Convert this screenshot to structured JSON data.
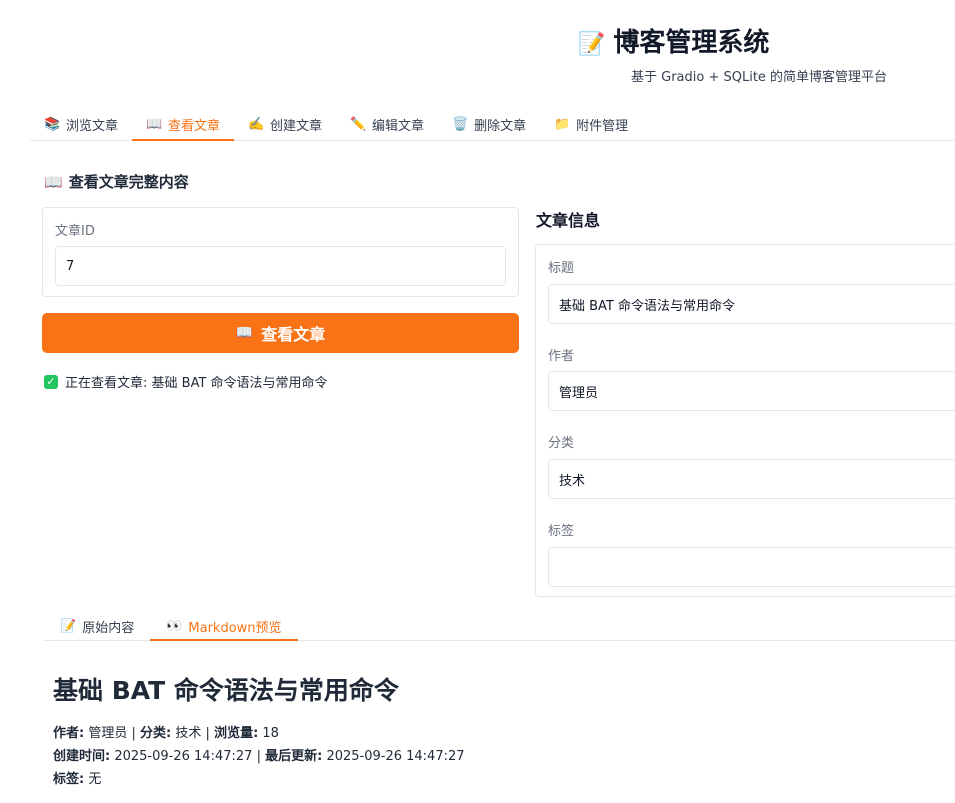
{
  "header": {
    "title": "博客管理系统",
    "title_icon": "memo-icon",
    "subtitle": "基于 Gradio + SQLite 的简单博客管理平台"
  },
  "tabs": [
    {
      "icon": "📚",
      "icon_name": "books-icon",
      "label": "浏览文章"
    },
    {
      "icon": "📖",
      "icon_name": "open-book-icon",
      "label": "查看文章",
      "active": true
    },
    {
      "icon": "✍️",
      "icon_name": "writing-hand-icon",
      "label": "创建文章"
    },
    {
      "icon": "✏️",
      "icon_name": "pencil-icon",
      "label": "编辑文章"
    },
    {
      "icon": "🗑️",
      "icon_name": "trash-icon",
      "label": "删除文章"
    },
    {
      "icon": "📁",
      "icon_name": "folder-icon",
      "label": "附件管理"
    }
  ],
  "view": {
    "section_icon": "📖",
    "section_title": "查看文章完整内容",
    "id_label": "文章ID",
    "id_value": "7",
    "button_icon": "📖",
    "button_label": "查看文章",
    "status_text": "正在查看文章: 基础 BAT 命令语法与常用命令"
  },
  "info": {
    "title": "文章信息",
    "fields": {
      "title_label": "标题",
      "title_value": "基础 BAT 命令语法与常用命令",
      "author_label": "作者",
      "author_value": "管理员",
      "category_label": "分类",
      "category_value": "技术",
      "tags_label": "标签",
      "tags_value": ""
    }
  },
  "sub_tabs": [
    {
      "icon": "📝",
      "label": "原始内容"
    },
    {
      "icon": "👀",
      "label": "Markdown预览",
      "active": true
    }
  ],
  "preview": {
    "h1": "基础 BAT 命令语法与常用命令",
    "author_key": "作者:",
    "author_val": "管理员",
    "category_key": "分类:",
    "category_val": "技术",
    "views_key": "浏览量:",
    "views_val": "18",
    "created_key": "创建时间:",
    "created_val": "2025-09-26 14:47:27",
    "updated_key": "最后更新:",
    "updated_val": "2025-09-26 14:47:27",
    "tags_key": "标签:",
    "tags_val": "无",
    "sep": "|"
  },
  "colors": {
    "accent": "#f97316",
    "check": "#22c55e"
  }
}
